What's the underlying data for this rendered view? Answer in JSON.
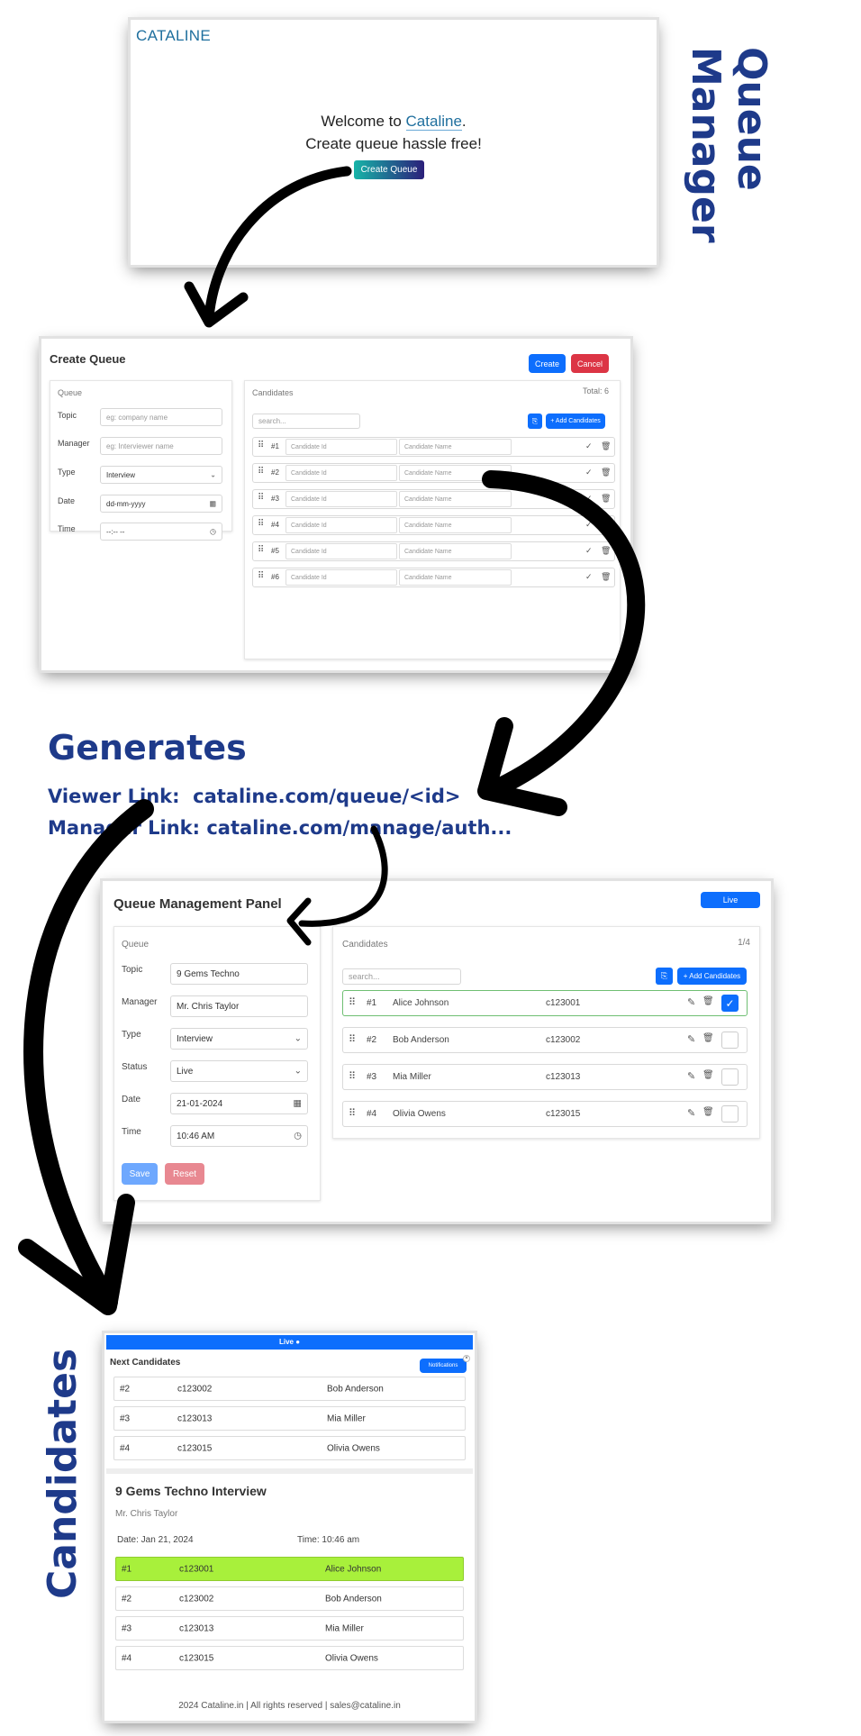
{
  "side_labels": {
    "queue_manager": "Queue Manager",
    "candidates": "Candidates"
  },
  "landing": {
    "brand": "CATALINE",
    "welcome_prefix": "Welcome to ",
    "welcome_brand": "Cataline",
    "welcome_suffix": ".",
    "tagline": "Create queue hassle free!",
    "cta": "Create Queue"
  },
  "create_queue": {
    "title": "Create Queue",
    "create_btn": "Create",
    "cancel_btn": "Cancel",
    "queue_heading": "Queue",
    "fields": {
      "topic_label": "Topic",
      "topic_placeholder": "eg: company name",
      "manager_label": "Manager",
      "manager_placeholder": "eg: Interviewer name",
      "type_label": "Type",
      "type_value": "Interview",
      "date_label": "Date",
      "date_placeholder": "dd-mm-yyyy",
      "time_label": "Time",
      "time_placeholder": "--:-- --"
    },
    "candidates_heading": "Candidates",
    "total": "Total: 6",
    "search_placeholder": "search...",
    "add_candidates": "+ Add Candidates",
    "id_placeholder": "Candidate Id",
    "name_placeholder": "Candidate Name",
    "rows": [
      "#1",
      "#2",
      "#3",
      "#4",
      "#5",
      "#6"
    ]
  },
  "generates": {
    "heading": "Generates",
    "viewer": "Viewer Link:  cataline.com/queue/<id>",
    "manager": "Manager Link: cataline.com/manage/auth..."
  },
  "management_panel": {
    "title": "Queue Management Panel",
    "live": "Live",
    "queue_heading": "Queue",
    "fields": {
      "topic_label": "Topic",
      "topic_value": "9 Gems Techno",
      "manager_label": "Manager",
      "manager_value": "Mr. Chris Taylor",
      "type_label": "Type",
      "type_value": "Interview",
      "status_label": "Status",
      "status_value": "Live",
      "date_label": "Date",
      "date_value": "21-01-2024",
      "time_label": "Time",
      "time_value": "10:46 AM"
    },
    "save_btn": "Save",
    "reset_btn": "Reset",
    "candidates_heading": "Candidates",
    "count": "1/4",
    "search_placeholder": "search...",
    "add_candidates": "+ Add Candidates",
    "rows": [
      {
        "no": "#1",
        "name": "Alice Johnson",
        "id": "c123001",
        "checked": true
      },
      {
        "no": "#2",
        "name": "Bob Anderson",
        "id": "c123002",
        "checked": false
      },
      {
        "no": "#3",
        "name": "Mia Miller",
        "id": "c123013",
        "checked": false
      },
      {
        "no": "#4",
        "name": "Olivia Owens",
        "id": "c123015",
        "checked": false
      }
    ]
  },
  "viewer": {
    "live": "Live",
    "next_heading": "Next Candidates",
    "notifications": "Notifications",
    "next_rows": [
      {
        "no": "#2",
        "id": "c123002",
        "name": "Bob Anderson"
      },
      {
        "no": "#3",
        "id": "c123013",
        "name": "Mia Miller"
      },
      {
        "no": "#4",
        "id": "c123015",
        "name": "Olivia Owens"
      }
    ],
    "interview_title": "9 Gems Techno Interview",
    "manager": "Mr. Chris Taylor",
    "date": "Date: Jan 21, 2024",
    "time": "Time: 10:46 am",
    "rows": [
      {
        "no": "#1",
        "id": "c123001",
        "name": "Alice Johnson",
        "current": true
      },
      {
        "no": "#2",
        "id": "c123002",
        "name": "Bob Anderson",
        "current": false
      },
      {
        "no": "#3",
        "id": "c123013",
        "name": "Mia Miller",
        "current": false
      },
      {
        "no": "#4",
        "id": "c123015",
        "name": "Olivia Owens",
        "current": false
      }
    ],
    "footer": "2024 Cataline.in | All rights reserved | sales@cataline.in"
  },
  "colors": {
    "label_blue": "#1e3a8a",
    "primary": "#0d6efd",
    "danger": "#dc3545",
    "current_row": "#a8f03b"
  }
}
